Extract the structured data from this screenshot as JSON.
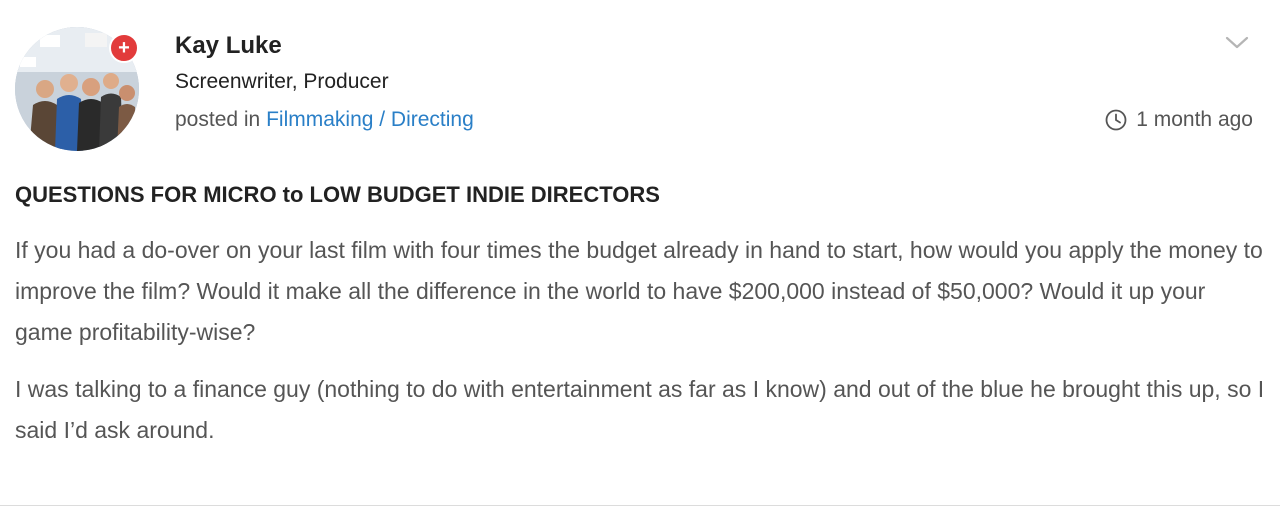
{
  "author": {
    "name": "Kay Luke",
    "role": "Screenwriter, Producer",
    "badge_symbol": "+",
    "avatar_icon": "group-photo"
  },
  "post_meta": {
    "posted_in_prefix": "posted in",
    "category": "Filmmaking / Directing",
    "timestamp": "1 month ago"
  },
  "post": {
    "title": "QUESTIONS FOR MICRO to LOW BUDGET INDIE DIRECTORS",
    "paragraphs": [
      "If you had a do-over on your last film with four times the budget already in hand to start, how would you apply the money to improve the film? Would it make all the difference in the world to have $200,000 instead of $50,000? Would it up your game profitability-wise?",
      "I was talking to a finance guy (nothing to do with entertainment as far as I know) and out of the blue he brought this up, so I said I’d ask around."
    ]
  },
  "colors": {
    "link": "#2a7fc7",
    "badge": "#e23b3b",
    "text_primary": "#222222",
    "text_secondary": "#555555"
  }
}
